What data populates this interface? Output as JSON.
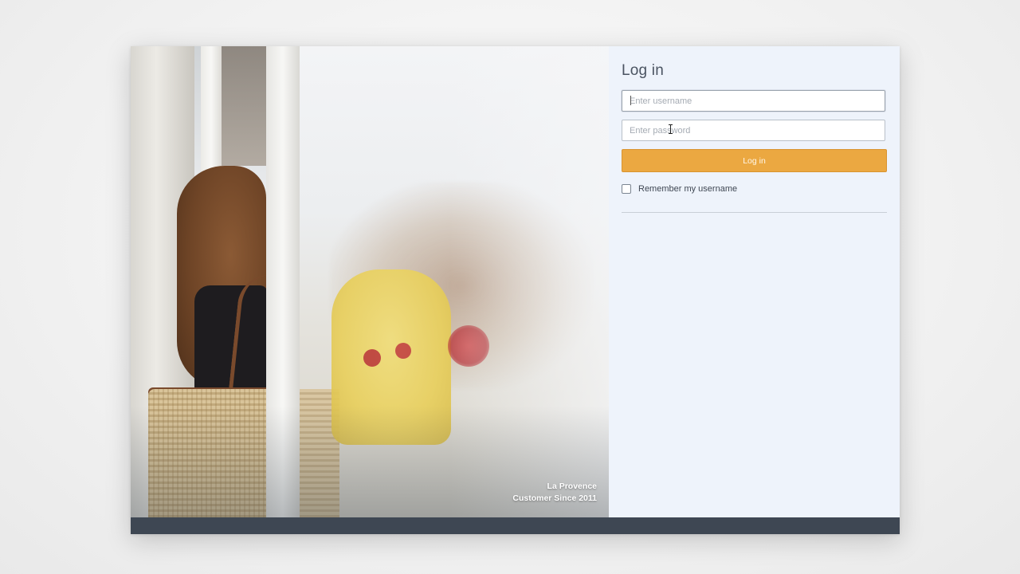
{
  "login": {
    "title": "Log in",
    "username_placeholder": "Enter username",
    "password_placeholder": "Enter password",
    "submit_label": "Log in",
    "remember_label": "Remember my username",
    "remember_checked": false
  },
  "caption": {
    "name": "La Provence",
    "subtitle": "Customer Since 2011"
  },
  "colors": {
    "accent": "#eba841",
    "panel_bg": "#eef3fb",
    "footer_bar": "#3e4753"
  }
}
